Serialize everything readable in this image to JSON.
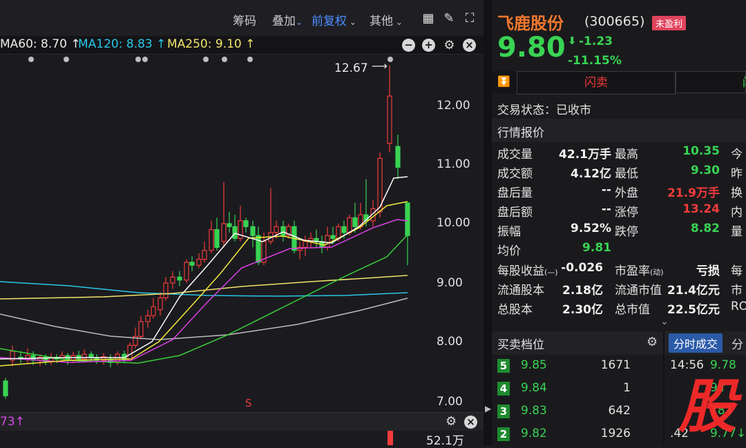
{
  "toolbar": {
    "chips": "筹码",
    "overlay": "叠加",
    "adjust": "前复权",
    "more": "其他"
  },
  "ma": {
    "ma60": "MA60: 8.70 ↑",
    "ma120": "MA120: 8.83 ↑",
    "ma250": "MA250: 9.10 ↑"
  },
  "chart": {
    "yticks": [
      "12.00",
      "11.00",
      "10.00",
      "9.00",
      "8.00",
      "7.00"
    ],
    "peak_label": "12.67",
    "s_marker": "S",
    "bottom_ma": "73↑",
    "volume_label": "52.1万"
  },
  "chart_data": {
    "type": "candlestick",
    "ylim": [
      7.0,
      12.75
    ],
    "yticks": [
      12,
      11,
      10,
      9,
      8,
      7
    ],
    "peak": 12.67,
    "last_close": 9.8
  },
  "stock": {
    "name": "飞鹿股份",
    "code": "(300665)",
    "badge": "未盈利",
    "price": "9.80",
    "change": "-1.23",
    "pct": "-11.15%"
  },
  "trade": {
    "flash_sell": "闪卖",
    "flash_right": "闪",
    "status": "交易状态：已收市",
    "section": "行情报价"
  },
  "quote": [
    {
      "l1": "成交量",
      "v1": "42.1万手",
      "l2": "最高",
      "v2": "10.35",
      "c2": "green",
      "l3": "今"
    },
    {
      "l1": "成交额",
      "v1": "4.12亿",
      "l2": "最低",
      "v2": "9.30",
      "c2": "green",
      "l3": "昨"
    },
    {
      "l1": "盘后量",
      "v1": "--",
      "l2": "外盘",
      "v2": "21.9万手",
      "c2": "red",
      "l3": "换"
    },
    {
      "l1": "盘后额",
      "v1": "--",
      "l2": "涨停",
      "v2": "13.24",
      "c2": "red",
      "l3": "内"
    },
    {
      "l1": "振幅",
      "v1": "9.52%",
      "l2": "跌停",
      "v2": "8.82",
      "c2": "green",
      "l3": "量"
    },
    {
      "l1": "均价",
      "v1": "9.81",
      "c1": "green",
      "l2": "",
      "v2": "",
      "c2": "",
      "l3": ""
    }
  ],
  "fund": [
    {
      "l1": "每股收益",
      "s1": "(—)",
      "v1": "-0.026",
      "l2": "市盈率",
      "s2": "(动)",
      "v2": "亏损",
      "l3": "每"
    },
    {
      "l1": "流通股本",
      "s1": "",
      "v1": "2.18亿",
      "l2": "流通市值",
      "s2": "",
      "v2": "21.4亿元",
      "l3": "市"
    },
    {
      "l1": "总股本",
      "s1": "",
      "v1": "2.30亿",
      "l2": "总市值",
      "s2": "",
      "v2": "22.5亿元",
      "l3": "RO"
    }
  ],
  "book": {
    "title": "买卖档位",
    "tab1": "分时成交",
    "tab2": "分",
    "rows": [
      {
        "lvl": "5",
        "price": "9.85",
        "vol": "1671"
      },
      {
        "lvl": "4",
        "price": "9.84",
        "vol": "1"
      },
      {
        "lvl": "3",
        "price": "9.83",
        "vol": "642"
      },
      {
        "lvl": "2",
        "price": "9.82",
        "vol": "1926"
      }
    ],
    "ticks": [
      {
        "time": "14:56",
        "price": "9.78"
      },
      {
        "time": "",
        "price": "9↑"
      },
      {
        "time": "",
        "price": "78↓"
      },
      {
        "time": ".42",
        "price": "9.77↓"
      }
    ]
  },
  "watermark": "股",
  "colors": {
    "red": "#f23b3b",
    "green": "#39d353",
    "ma120": "#29c7e8",
    "ma250": "#f1e36b",
    "bg": "#1b1b1f"
  }
}
